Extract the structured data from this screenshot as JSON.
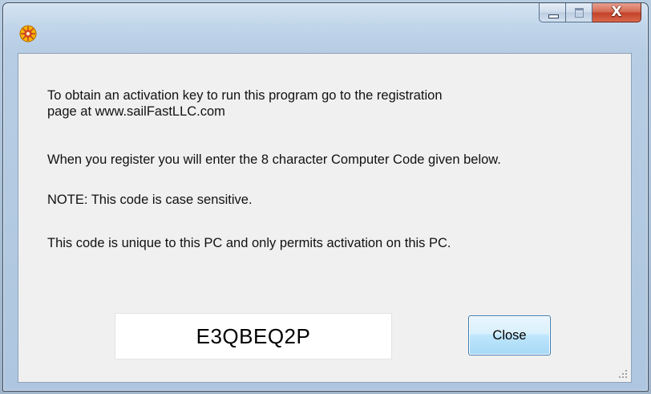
{
  "window": {
    "title": "",
    "icon": "sun-wheel-icon",
    "caption_buttons": [
      "minimize",
      "maximize",
      "close"
    ]
  },
  "message": {
    "line1": "To obtain an activation key to run this program go to the registration",
    "line2": "page at  www.sailFastLLC.com",
    "line3": "When you register you will enter the 8 character Computer Code given below.",
    "line4": "NOTE: This code is case sensitive.",
    "line5": "This code is unique to this PC and only permits activation on this PC."
  },
  "computer_code": "E3QBEQ2P",
  "buttons": {
    "close_label": "Close",
    "title_close_glyph": "X"
  },
  "colors": {
    "close_caption": "#c2412a",
    "button_border": "#3c7fb1",
    "client_bg": "#f0f0f0"
  }
}
